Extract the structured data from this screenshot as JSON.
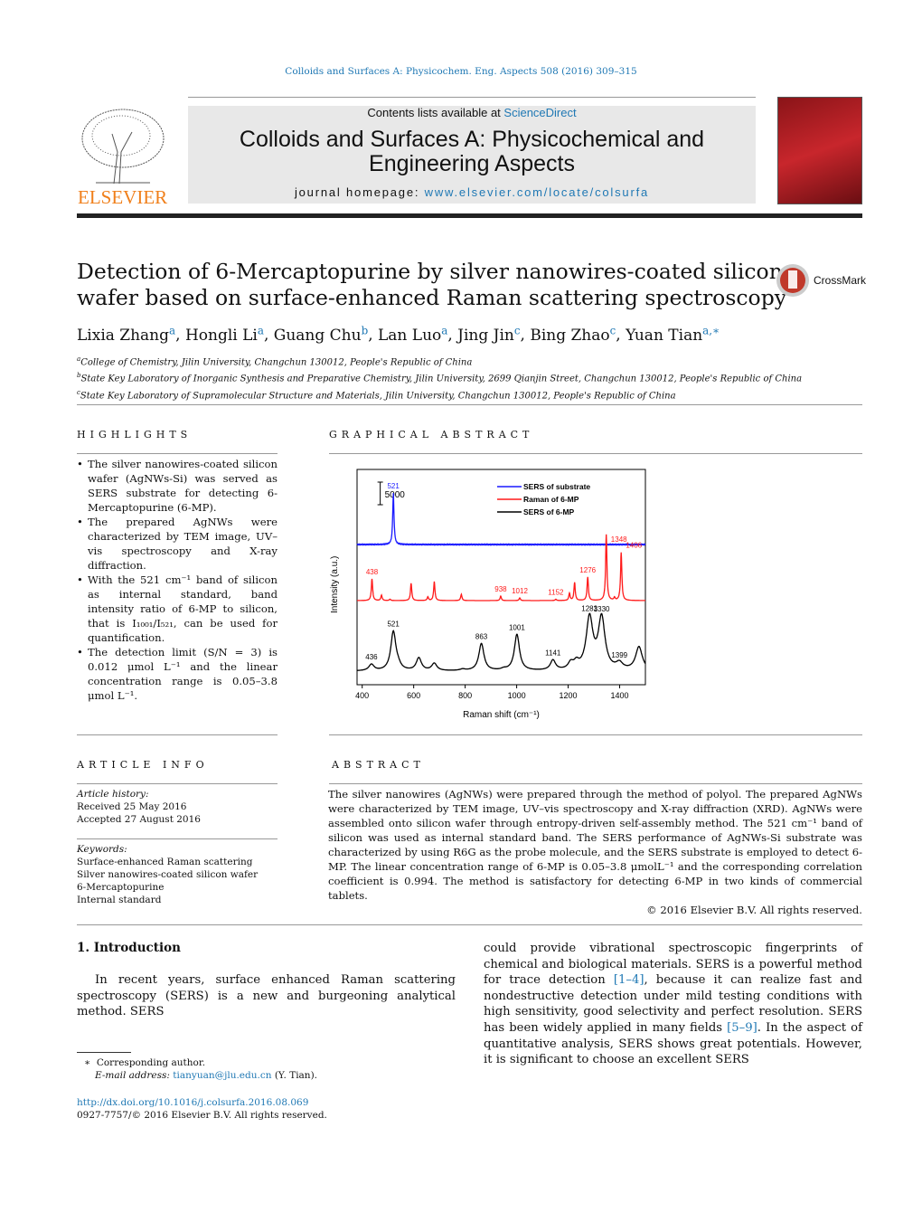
{
  "citation": "Colloids and Surfaces A: Physicochem. Eng. Aspects 508 (2016) 309–315",
  "header": {
    "contents_prefix": "Contents lists available at ",
    "sciencedirect": "ScienceDirect",
    "journal_line1": "Colloids and Surfaces A: Physicochemical and",
    "journal_line2": "Engineering Aspects",
    "homepage_prefix": "journal homepage: ",
    "homepage_url": "www.elsevier.com/locate/colsurfa",
    "publisher": "ELSEVIER",
    "publisher_color": "#f07f1a"
  },
  "title_line1": "Detection of 6-Mercaptopurine by silver nanowires-coated silicon",
  "title_line2": "wafer based on surface-enhanced Raman scattering spectroscopy",
  "crossmark": "CrossMark",
  "authors": [
    {
      "name": "Lixia Zhang",
      "aff": "a"
    },
    {
      "name": "Hongli Li",
      "aff": "a"
    },
    {
      "name": "Guang Chu",
      "aff": "b"
    },
    {
      "name": "Lan Luo",
      "aff": "a"
    },
    {
      "name": "Jing Jin",
      "aff": "c"
    },
    {
      "name": "Bing Zhao",
      "aff": "c"
    },
    {
      "name": "Yuan Tian",
      "aff": "a,∗"
    }
  ],
  "affiliations": [
    {
      "key": "a",
      "text": "College of Chemistry, Jilin University, Changchun 130012, People's Republic of China"
    },
    {
      "key": "b",
      "text": "State Key Laboratory of Inorganic Synthesis and Preparative Chemistry, Jilin University, 2699 Qianjin Street, Changchun 130012, People's Republic of China"
    },
    {
      "key": "c",
      "text": "State Key Laboratory of Supramolecular Structure and Materials, Jilin University, Changchun 130012, People's Republic of China"
    }
  ],
  "highlights": {
    "heading": "HIGHLIGHTS",
    "items": [
      "The silver nanowires-coated silicon wafer (AgNWs-Si) was served as SERS substrate for detecting 6-Mercaptopurine (6-MP).",
      "The prepared AgNWs were characterized by TEM image, UV–vis spectroscopy and X-ray diffraction.",
      "With the 521 cm⁻¹ band of silicon as internal standard, band intensity ratio of 6-MP to silicon, that is I₁₀₀₁/I₅₂₁, can be used for quantification.",
      "The detection limit (S/N = 3) is 0.012 μmol L⁻¹ and the linear concentration range is 0.05–3.8 μmol L⁻¹."
    ]
  },
  "graphical_abstract": {
    "heading": "GRAPHICAL ABSTRACT"
  },
  "chart_data": {
    "type": "line",
    "xlabel": "Raman shift (cm⁻¹)",
    "ylabel": "Intensity (a.u.)",
    "xlim": [
      380,
      1500
    ],
    "ylim": [
      0,
      47600
    ],
    "xticks": [
      400,
      600,
      800,
      1000,
      1200,
      1400
    ],
    "scale_bar_label": "5000",
    "scale_bar_value": 5000,
    "grid": false,
    "legend_placement": "top-right",
    "series": [
      {
        "name": "SERS of substrate",
        "color": "#1a1aff",
        "baseline": 31000,
        "width": 3,
        "peaks": [
          [
            521,
            11400
          ]
        ],
        "labels": [
          521
        ]
      },
      {
        "name": "Raman of 6-MP",
        "color": "#ff1a1a",
        "baseline": 18600,
        "width": 3,
        "peaks": [
          [
            438,
            4800
          ],
          [
            475,
            1200
          ],
          [
            508,
            300
          ],
          [
            590,
            3800
          ],
          [
            655,
            800
          ],
          [
            680,
            4200
          ],
          [
            785,
            1400
          ],
          [
            938,
            1000
          ],
          [
            1012,
            600
          ],
          [
            1152,
            300
          ],
          [
            1205,
            1600
          ],
          [
            1225,
            4000
          ],
          [
            1276,
            5200
          ],
          [
            1348,
            14600
          ],
          [
            1380,
            600
          ],
          [
            1406,
            10600
          ]
        ],
        "labels": [
          438,
          938,
          1012,
          1152,
          1276,
          1348,
          1406
        ]
      },
      {
        "name": "SERS of 6-MP",
        "color": "#000000",
        "baseline": 3000,
        "width": 12,
        "peaks": [
          [
            436,
            1400
          ],
          [
            521,
            8600
          ],
          [
            540,
            800
          ],
          [
            620,
            2800
          ],
          [
            680,
            1600
          ],
          [
            790,
            300
          ],
          [
            863,
            6000
          ],
          [
            950,
            300
          ],
          [
            1001,
            8000
          ],
          [
            1141,
            2200
          ],
          [
            1210,
            1400
          ],
          [
            1232,
            1400
          ],
          [
            1283,
            11400
          ],
          [
            1330,
            11400
          ],
          [
            1399,
            1400
          ],
          [
            1475,
            5200
          ]
        ],
        "labels": [
          436,
          521,
          863,
          1001,
          1141,
          1283,
          1330,
          1399
        ]
      }
    ]
  },
  "article_info": {
    "heading": "ARTICLE INFO",
    "history_label": "Article history:",
    "received": "Received 25 May 2016",
    "accepted": "Accepted 27 August 2016",
    "keywords_label": "Keywords:",
    "keywords": [
      "Surface-enhanced Raman scattering",
      "Silver nanowires-coated silicon wafer",
      "6-Mercaptopurine",
      "Internal standard"
    ]
  },
  "abstract": {
    "heading": "ABSTRACT",
    "text": "The silver nanowires (AgNWs) were prepared through the method of polyol. The prepared AgNWs were characterized by TEM image, UV–vis spectroscopy and X-ray diffraction (XRD). AgNWs were assembled onto silicon wafer through entropy-driven self-assembly method. The 521 cm⁻¹ band of silicon was used as internal standard band. The SERS performance of AgNWs-Si substrate was characterized by using R6G as the probe molecule, and the SERS substrate is employed to detect 6-MP. The linear concentration range of 6-MP is 0.05–3.8 μmolL⁻¹ and the corresponding correlation coefficient is 0.994. The method is satisfactory for detecting 6-MP in two kinds of commercial tablets.",
    "copyright": "© 2016 Elsevier B.V. All rights reserved."
  },
  "intro": {
    "heading": "1.  Introduction",
    "col1": "In recent years, surface enhanced Raman scattering spectroscopy (SERS) is a new and burgeoning analytical method. SERS",
    "col2_a": "could provide vibrational spectroscopic fingerprints of chemical and biological materials. SERS is a powerful method for trace detection ",
    "ref1": "[1–4]",
    "col2_b": ", because it can realize fast and nondestructive detection under mild testing conditions with high sensitivity, good selectivity and perfect resolution. SERS has been widely applied in many fields ",
    "ref2": "[5–9]",
    "col2_c": ". In the aspect of quantitative analysis, SERS shows great potentials. However, it is significant to choose an excellent SERS"
  },
  "footnote": {
    "star": "∗",
    "corresponding": "Corresponding author.",
    "email_label": "E-mail address: ",
    "email": "tianyuan@jlu.edu.cn",
    "email_suffix": " (Y. Tian)."
  },
  "doi": "http://dx.doi.org/10.1016/j.colsurfa.2016.08.069",
  "issn": "0927-7757/© 2016 Elsevier B.V. All rights reserved."
}
